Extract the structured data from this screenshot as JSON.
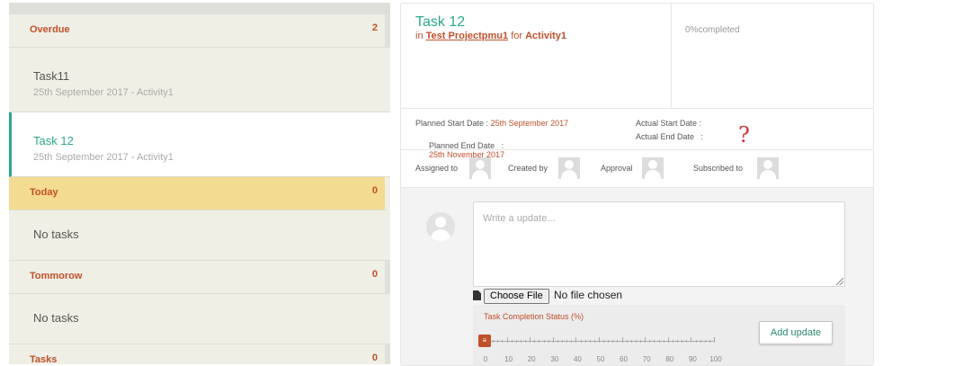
{
  "groups": {
    "overdue": {
      "label": "Overdue",
      "count": "2"
    },
    "today": {
      "label": "Today",
      "count": "0"
    },
    "tomorrow": {
      "label": "Tommorow",
      "count": "0"
    },
    "tasks": {
      "label": "Tasks",
      "count": "0"
    }
  },
  "overdue_tasks": [
    {
      "name": "Task11",
      "sub": "25th September 2017 - Activity1"
    },
    {
      "name": "Task 12",
      "sub": "25th September 2017 - Activity1"
    }
  ],
  "no_tasks": "No tasks",
  "detail": {
    "title": "Task 12",
    "in_prefix": "in",
    "project": "Test Projectpmu1",
    "for_word": "for",
    "activity": "Activity1",
    "completed": "0%completed",
    "planned_start_label": "Planned Start Date :",
    "planned_start_value": "25th September 2017",
    "planned_end_label": "Planned End Date   :",
    "planned_end_value": "25th November 2017",
    "actual_start_label": "Actual Start Date :",
    "actual_end_label": "Actual End Date   :",
    "annotation": "?",
    "assigned_to": "Assigned to",
    "created_by": "Created by",
    "approval": "Approval",
    "subscribed_to": "Subscribed to"
  },
  "update": {
    "placeholder": "Write a update...",
    "choose_file": "Choose File",
    "no_file": "No file chosen",
    "status_label": "Task Completion Status (%)",
    "progress_percent": 0,
    "slider_handle_glyph": "≡",
    "ticks": [
      "0",
      "10",
      "20",
      "30",
      "40",
      "50",
      "60",
      "70",
      "80",
      "90",
      "100"
    ],
    "add_button": "Add update"
  },
  "colors": {
    "accent": "#2aa98e",
    "orange": "#c0502a",
    "today_bg": "#f3dc91"
  }
}
